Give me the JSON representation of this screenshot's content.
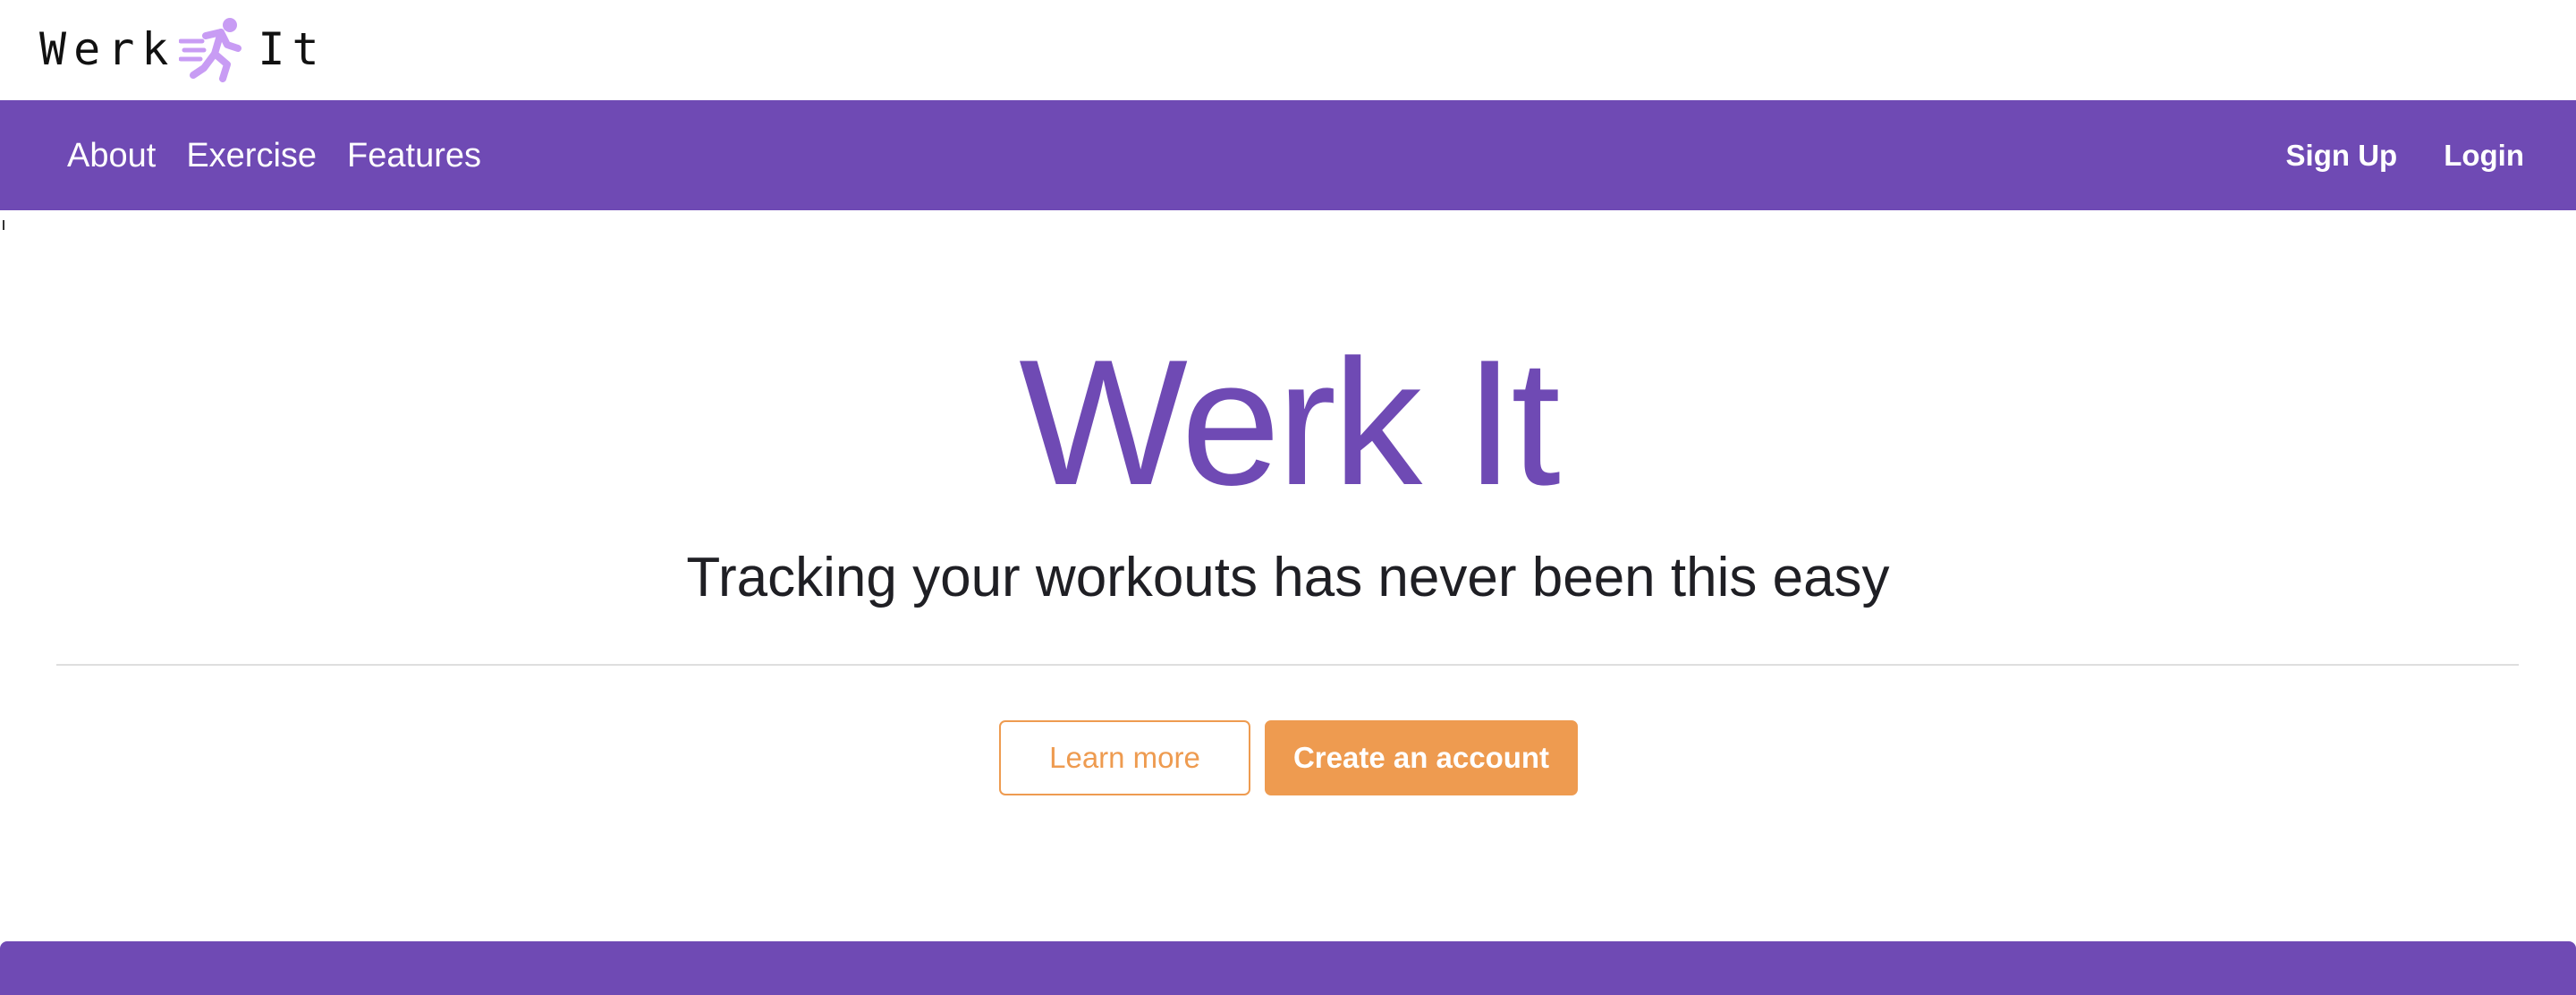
{
  "brand": {
    "word_left": "Werk",
    "word_right": "It",
    "icon": "running-person-icon",
    "icon_color": "#c89cf4"
  },
  "nav": {
    "links": [
      {
        "label": "About"
      },
      {
        "label": "Exercise"
      },
      {
        "label": "Features"
      }
    ],
    "signup_label": "Sign Up",
    "login_label": "Login",
    "background_color": "#6f4ab4"
  },
  "hero": {
    "title": "Werk It",
    "subtitle": "Tracking your workouts has never been this easy",
    "learn_more_label": "Learn more",
    "create_account_label": "Create an account",
    "accent_color": "#6f4ab4",
    "button_color": "#ee9b50"
  }
}
